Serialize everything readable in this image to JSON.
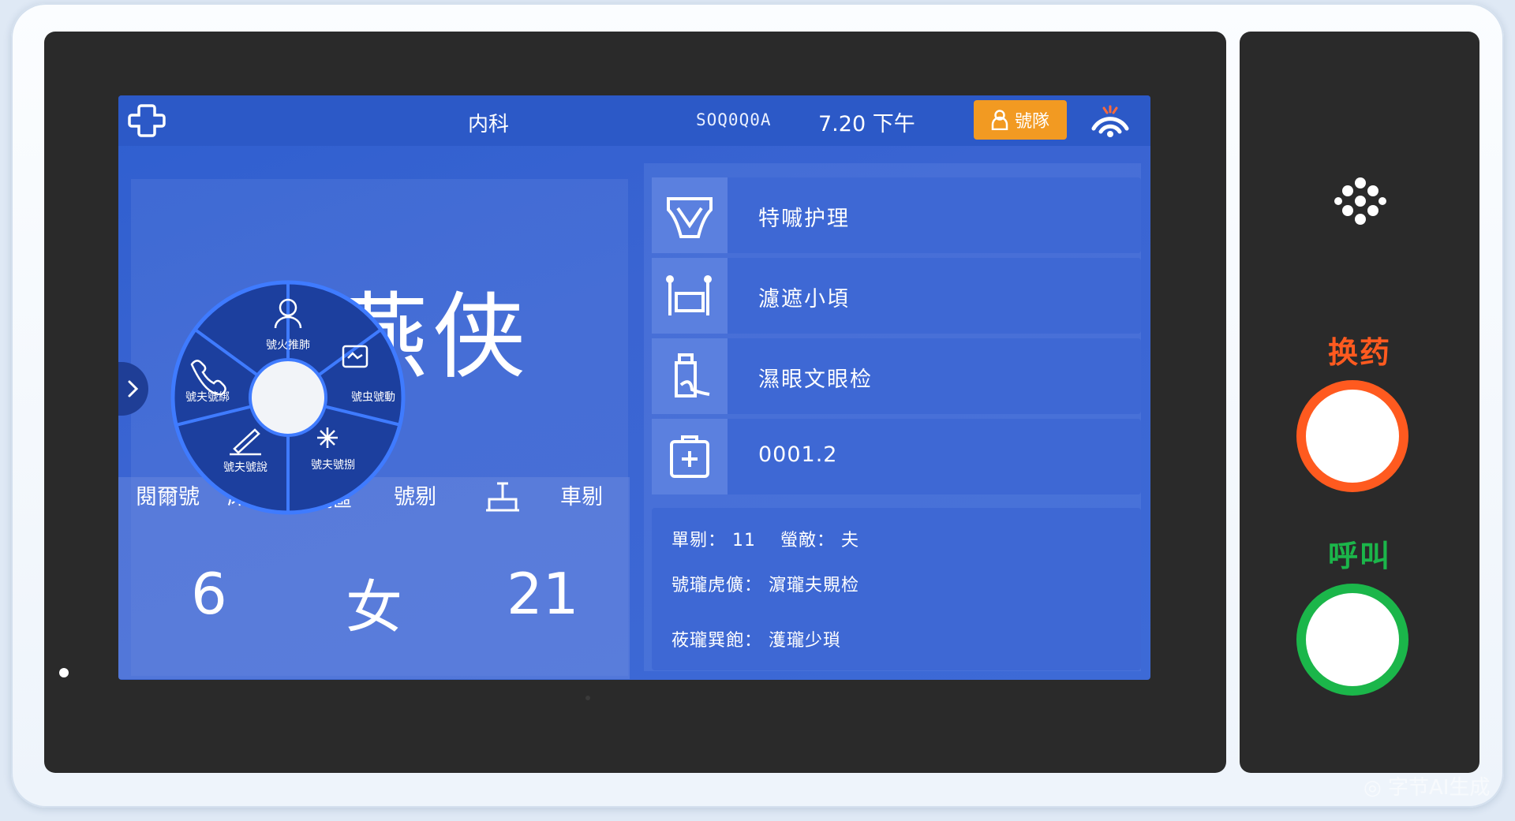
{
  "topbar": {
    "department": "内科",
    "code": "SOQ0Q0A",
    "time": "7.20 下午",
    "user_button_label": "號隊"
  },
  "patient": {
    "name": "陳燕侠",
    "labels": [
      "閱爾號",
      "床號",
      "病區",
      "號剔",
      "車剔"
    ],
    "values": {
      "bed": "6",
      "gender": "女",
      "age": "21"
    }
  },
  "radial_menu": {
    "items": [
      {
        "label": "號火推肺",
        "icon": "person-icon"
      },
      {
        "label": "號虫號動",
        "icon": "display-icon"
      },
      {
        "label": "號夫號捌",
        "icon": "spark-icon"
      },
      {
        "label": "號夫號說",
        "icon": "pen-icon"
      },
      {
        "label": "號夫號綁",
        "icon": "phone-icon"
      }
    ]
  },
  "services": [
    {
      "label": "特嘁护理",
      "icon": "diaper-icon"
    },
    {
      "label": "濾遮小頃",
      "icon": "meal-icon"
    },
    {
      "label": "濕眼文眼检",
      "icon": "bottle-icon"
    },
    {
      "label": "0001.2",
      "icon": "medkit-icon"
    }
  ],
  "details": {
    "row1_a": "單剔： 11",
    "row1_b": "螢敵： 夫",
    "row2": "號瓏虎儣： 濵瓏夫覞检",
    "row3": "莜瓏巽飽： 濩瓏少瑣"
  },
  "side": {
    "dressing_label": "换药",
    "call_label": "呼叫",
    "dressing_color": "#ff5a1f",
    "call_color": "#1bb64a"
  },
  "watermark": "◎ 字节AI生成"
}
